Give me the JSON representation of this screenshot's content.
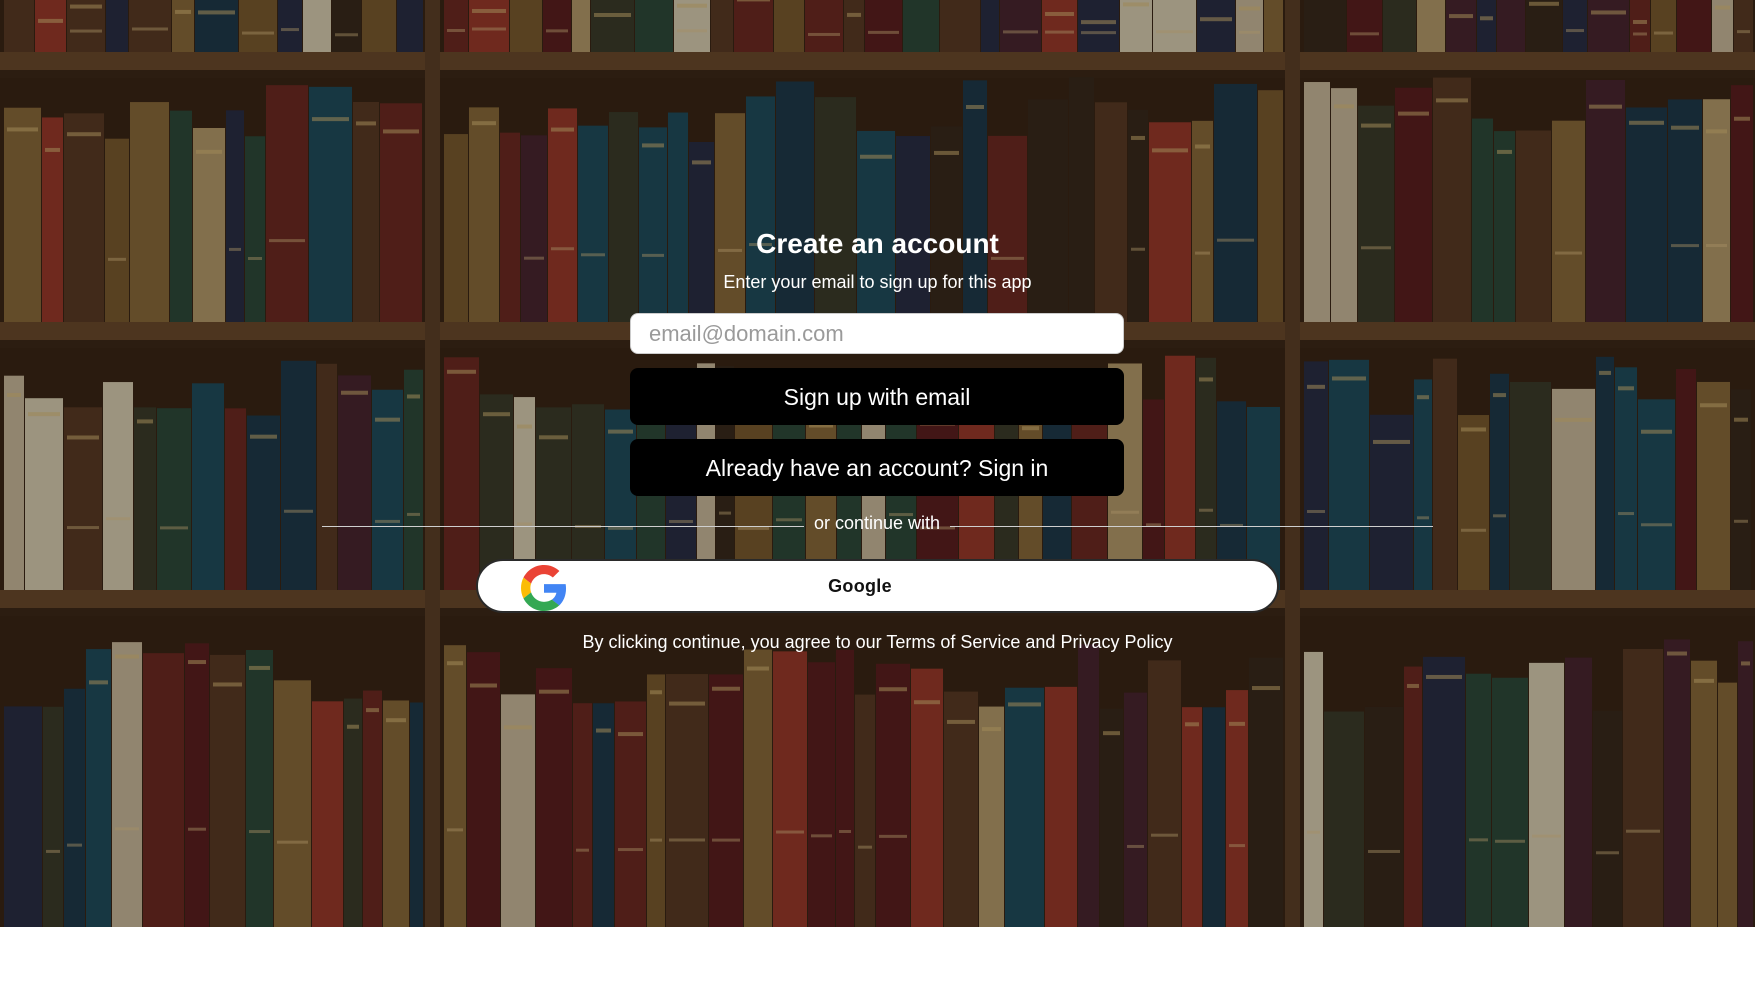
{
  "signup": {
    "title": "Create an account",
    "subtitle": "Enter your email to sign up for this app",
    "email_placeholder": "email@domain.com",
    "email_value": "",
    "signup_button": "Sign up with email",
    "signin_button": "Already have an account? Sign in",
    "divider": "or continue with",
    "google_button": "Google",
    "terms_prefix": "By clicking continue, you agree to our",
    "terms_link": "Terms of Service",
    "terms_and": "and",
    "privacy_link": "Privacy Policy"
  },
  "icons": {
    "google": "google-g-icon"
  },
  "colors": {
    "button_background": "#000000",
    "text": "#ffffff",
    "google_blue": "#4285F4",
    "google_red": "#EA4335",
    "google_yellow": "#FBBC05",
    "google_green": "#34A853"
  }
}
